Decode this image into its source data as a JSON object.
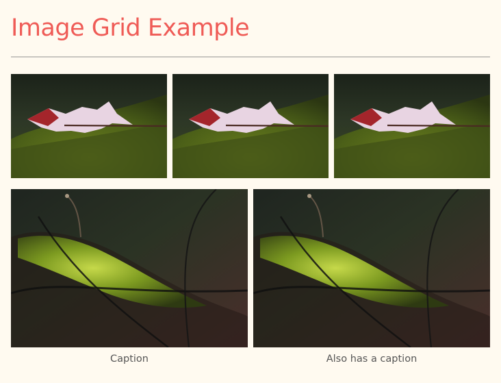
{
  "page": {
    "title": "Image Grid Example"
  },
  "grid": {
    "row1": [
      {
        "image": "leaf-on-moss-photo"
      },
      {
        "image": "leaf-on-moss-photo"
      },
      {
        "image": "leaf-on-moss-photo"
      }
    ],
    "row2": [
      {
        "image": "moss-on-branch-photo",
        "caption": "Caption"
      },
      {
        "image": "moss-on-branch-photo",
        "caption": "Also has a caption"
      }
    ]
  },
  "colors": {
    "background": "#fffaf0",
    "title": "#ef5b56",
    "divider": "#c8c6c0",
    "caption": "#555555"
  }
}
